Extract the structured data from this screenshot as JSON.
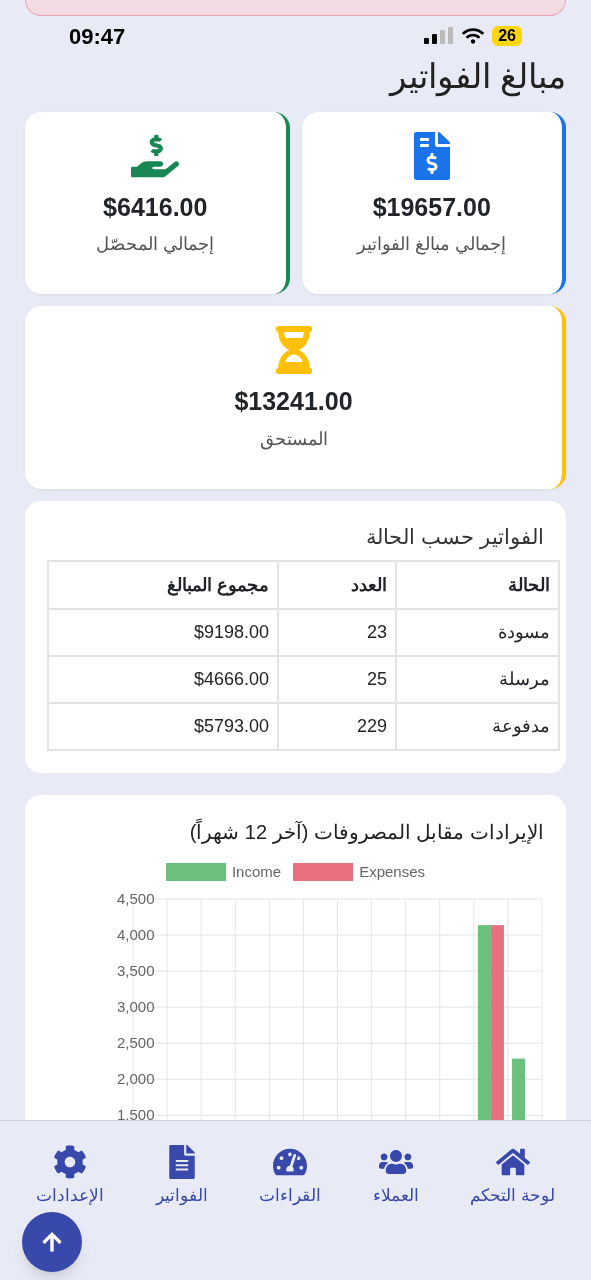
{
  "status_bar": {
    "time": "09:47",
    "battery": "26"
  },
  "page_title": "مبالغ الفواتير",
  "summary_cards": [
    {
      "kind": "invoices",
      "amount": "$19657.00",
      "label": "إجمالي مبالغ الفواتير",
      "color": "#1a73e8"
    },
    {
      "kind": "collected",
      "amount": "$6416.00",
      "label": "إجمالي المحصّل",
      "color": "#198754"
    },
    {
      "kind": "due",
      "amount": "$13241.00",
      "label": "المستحق",
      "color": "#ffc107"
    }
  ],
  "status_table": {
    "title": "الفواتير حسب الحالة",
    "columns": [
      "الحالة",
      "العدد",
      "مجموع المبالغ"
    ],
    "rows": [
      [
        "مسودة",
        "23",
        "$9198.00"
      ],
      [
        "مرسلة",
        "25",
        "$4666.00"
      ],
      [
        "مدفوعة",
        "229",
        "$5793.00"
      ]
    ]
  },
  "chart_card": {
    "title": "الإيرادات مقابل المصروفات (آخر 12 شهراً)",
    "chart_data": {
      "type": "bar",
      "grid": true,
      "legend": "top",
      "ylim": [
        1200,
        4500
      ],
      "yticks": [
        {
          "value": 1500,
          "label": "1,500"
        },
        {
          "value": 2000,
          "label": "2,000"
        },
        {
          "value": 2500,
          "label": "2,500"
        },
        {
          "value": 3000,
          "label": "3,000"
        },
        {
          "value": 3500,
          "label": "3,500"
        },
        {
          "value": 4000,
          "label": "4,000"
        },
        {
          "value": 4500,
          "label": "4,500"
        }
      ],
      "series": [
        {
          "name": "Income",
          "color": "#6cc07e",
          "values": [
            null,
            null,
            null,
            null,
            null,
            null,
            null,
            null,
            null,
            null,
            4130,
            2280
          ]
        },
        {
          "name": "Expenses",
          "color": "#e76f7e",
          "values": [
            null,
            null,
            null,
            null,
            null,
            null,
            null,
            null,
            null,
            null,
            4130,
            null
          ]
        }
      ]
    }
  },
  "bottom_nav": [
    {
      "kind": "home",
      "label": "لوحة التحكم"
    },
    {
      "kind": "users",
      "label": "العملاء"
    },
    {
      "kind": "gauge",
      "label": "القراءات"
    },
    {
      "kind": "invoice",
      "label": "الفواتير"
    },
    {
      "kind": "settings",
      "label": "الإعدادات"
    }
  ]
}
